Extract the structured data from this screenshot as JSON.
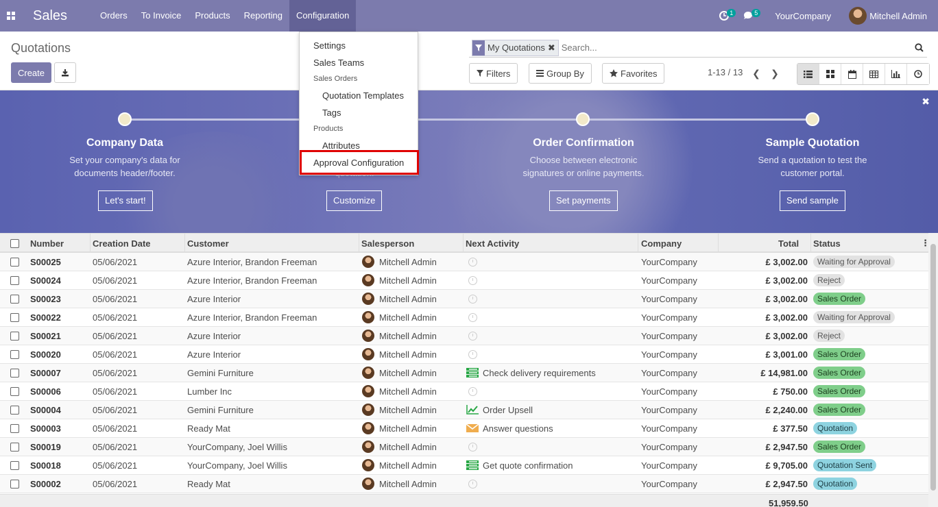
{
  "navbar": {
    "app_name": "Sales",
    "menu": [
      "Orders",
      "To Invoice",
      "Products",
      "Reporting",
      "Configuration"
    ],
    "activity_count": "1",
    "message_count": "5",
    "company": "YourCompany",
    "user": "Mitchell Admin",
    "color": "#7c7bad"
  },
  "control": {
    "title": "Quotations",
    "create_label": "Create",
    "facet": "My Quotations",
    "search_placeholder": "Search...",
    "filters_label": "Filters",
    "groupby_label": "Group By",
    "favorites_label": "Favorites",
    "pager": "1-13 / 13"
  },
  "dropdown": {
    "settings": "Settings",
    "sales_teams": "Sales Teams",
    "sales_orders_header": "Sales Orders",
    "quotation_templates": "Quotation Templates",
    "tags": "Tags",
    "products_header": "Products",
    "attributes": "Attributes",
    "approval_configuration": "Approval Configuration"
  },
  "banner": {
    "steps": [
      {
        "title": "Company Data",
        "line1": "Set your company's data for",
        "line2": "documents header/footer.",
        "button": "Let's start!"
      },
      {
        "title": "",
        "line1": "",
        "line2": "quotation.",
        "button": "Customize"
      },
      {
        "title": "Order Confirmation",
        "line1": "Choose between electronic",
        "line2": "signatures or online payments.",
        "button": "Set payments"
      },
      {
        "title": "Sample Quotation",
        "line1": "Send a quotation to test the",
        "line2": "customer portal.",
        "button": "Send sample"
      }
    ]
  },
  "table": {
    "headers": {
      "number": "Number",
      "creation_date": "Creation Date",
      "customer": "Customer",
      "salesperson": "Salesperson",
      "next_activity": "Next Activity",
      "company": "Company",
      "total": "Total",
      "status": "Status"
    },
    "rows": [
      {
        "number": "S00025",
        "date": "05/06/2021",
        "customer": "Azure Interior, Brandon Freeman",
        "salesperson": "Mitchell Admin",
        "activity": "",
        "company": "YourCompany",
        "total": "£ 3,002.00",
        "status": "Waiting for Approval",
        "status_color": "grey"
      },
      {
        "number": "S00024",
        "date": "05/06/2021",
        "customer": "Azure Interior, Brandon Freeman",
        "salesperson": "Mitchell Admin",
        "activity": "",
        "company": "YourCompany",
        "total": "£ 3,002.00",
        "status": "Reject",
        "status_color": "grey"
      },
      {
        "number": "S00023",
        "date": "05/06/2021",
        "customer": "Azure Interior",
        "salesperson": "Mitchell Admin",
        "activity": "",
        "company": "YourCompany",
        "total": "£ 3,002.00",
        "status": "Sales Order",
        "status_color": "green"
      },
      {
        "number": "S00022",
        "date": "05/06/2021",
        "customer": "Azure Interior, Brandon Freeman",
        "salesperson": "Mitchell Admin",
        "activity": "",
        "company": "YourCompany",
        "total": "£ 3,002.00",
        "status": "Waiting for Approval",
        "status_color": "grey"
      },
      {
        "number": "S00021",
        "date": "05/06/2021",
        "customer": "Azure Interior",
        "salesperson": "Mitchell Admin",
        "activity": "",
        "company": "YourCompany",
        "total": "£ 3,002.00",
        "status": "Reject",
        "status_color": "grey"
      },
      {
        "number": "S00020",
        "date": "05/06/2021",
        "customer": "Azure Interior",
        "salesperson": "Mitchell Admin",
        "activity": "",
        "company": "YourCompany",
        "total": "£ 3,001.00",
        "status": "Sales Order",
        "status_color": "green"
      },
      {
        "number": "S00007",
        "date": "05/06/2021",
        "customer": "Gemini Furniture",
        "salesperson": "Mitchell Admin",
        "activity": "Check delivery requirements",
        "activity_icon": "todo-list-icon",
        "company": "YourCompany",
        "total": "£ 14,981.00",
        "status": "Sales Order",
        "status_color": "green"
      },
      {
        "number": "S00006",
        "date": "05/06/2021",
        "customer": "Lumber Inc",
        "salesperson": "Mitchell Admin",
        "activity": "",
        "company": "YourCompany",
        "total": "£ 750.00",
        "status": "Sales Order",
        "status_color": "green"
      },
      {
        "number": "S00004",
        "date": "05/06/2021",
        "customer": "Gemini Furniture",
        "salesperson": "Mitchell Admin",
        "activity": "Order Upsell",
        "activity_icon": "line-chart-icon",
        "company": "YourCompany",
        "total": "£ 2,240.00",
        "status": "Sales Order",
        "status_color": "green"
      },
      {
        "number": "S00003",
        "date": "05/06/2021",
        "customer": "Ready Mat",
        "salesperson": "Mitchell Admin",
        "activity": "Answer questions",
        "activity_icon": "envelope-icon",
        "company": "YourCompany",
        "total": "£ 377.50",
        "status": "Quotation",
        "status_color": "blue"
      },
      {
        "number": "S00019",
        "date": "05/06/2021",
        "customer": "YourCompany, Joel Willis",
        "salesperson": "Mitchell Admin",
        "activity": "",
        "company": "YourCompany",
        "total": "£ 2,947.50",
        "status": "Sales Order",
        "status_color": "green"
      },
      {
        "number": "S00018",
        "date": "05/06/2021",
        "customer": "YourCompany, Joel Willis",
        "salesperson": "Mitchell Admin",
        "activity": "Get quote confirmation",
        "activity_icon": "todo-list-icon",
        "company": "YourCompany",
        "total": "£ 9,705.00",
        "status": "Quotation Sent",
        "status_color": "blue"
      },
      {
        "number": "S00002",
        "date": "05/06/2021",
        "customer": "Ready Mat",
        "salesperson": "Mitchell Admin",
        "activity": "",
        "company": "YourCompany",
        "total": "£ 2,947.50",
        "status": "Quotation",
        "status_color": "blue"
      }
    ],
    "total_sum": "51,959.50"
  }
}
